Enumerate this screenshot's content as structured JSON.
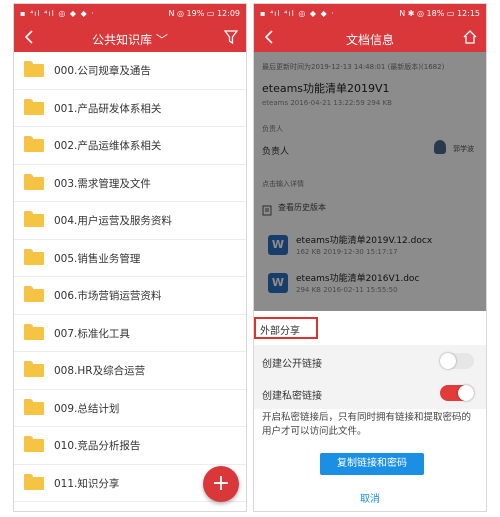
{
  "left": {
    "status": {
      "left_icons": "▪ ⁴ıl ⁴ıl ◎ ◆ ◆ ·",
      "right": "N ◎ 19% ▭ 12:09"
    },
    "title": "公共知识库 ﹀",
    "folders": [
      "000.公司规章及通告",
      "001.产品研发体系相关",
      "002.产品运维体系相关",
      "003.需求管理及文件",
      "004.用户运营及服务资料",
      "005.销售业务管理",
      "006.市场营销运营资料",
      "007.标准化工具",
      "008.HR及综合运营",
      "009.总结计划",
      "010.竞品分析报告",
      "011.知识分享"
    ],
    "fab": "+"
  },
  "right": {
    "status": {
      "left_icons": "▪ ⁴ıl ⁴ıl ◎ ◆ ◆ ·",
      "right": "N ✱ ◎ 18% ▭ 12:15"
    },
    "title": "文档信息",
    "update_line": "最后更新时间为2019-12-13 14:48:01 (最新版本)(1682)",
    "doc_title": "eteams功能清单2019V1",
    "doc_meta": "eteams  2016-04-21 13:22:59  294 KB",
    "section_owner": "负责人",
    "owner_label": "负责人",
    "owner_name": "郭学波",
    "section_detail": "点击输入详情",
    "history_label": "查看历史版本",
    "versions": [
      {
        "name": "eteams功能清单2019V.12.docx",
        "meta": "162 KB  2019-12-30 15:17:17"
      },
      {
        "name": "eteams功能清单2016V1.doc",
        "meta": "294 KB  2016-02-11 15:55:50"
      }
    ],
    "sheet": {
      "header": "外部分享",
      "public_link": "创建公开链接",
      "private_link": "创建私密链接",
      "public_on": false,
      "private_on": true,
      "hint": "开启私密链接后，只有同时拥有链接和提取密码的用户才可以访问此文件。",
      "copy_button": "复制链接和密码",
      "cancel": "取消"
    }
  },
  "colors": {
    "brand_red": "#d9373a",
    "blue": "#1a8fe3",
    "folder": "#f6c443"
  }
}
